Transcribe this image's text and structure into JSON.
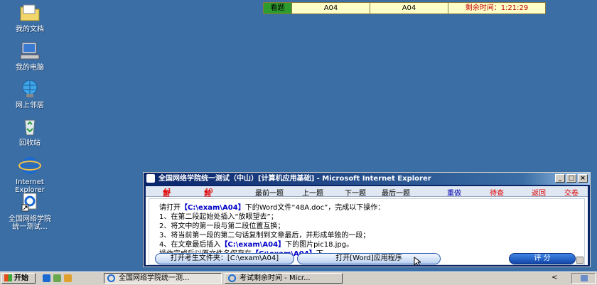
{
  "status_bar": {
    "badge": "看题",
    "cell1": "A04",
    "cell2": "A04",
    "time_remaining": "剩余时间：1:21:29"
  },
  "desktop_icons": [
    {
      "label": "我的文档",
      "icon": "folder-icon"
    },
    {
      "label": "我的电脑",
      "icon": "computer-icon"
    },
    {
      "label": "网上邻居",
      "icon": "network-icon"
    },
    {
      "label": "回收站",
      "icon": "recycle-bin-icon"
    },
    {
      "label": "Internet\nExplorer",
      "icon": "ie-icon"
    },
    {
      "label": "全国网络学院\n统一测试...",
      "icon": "shortcut-icon"
    }
  ],
  "exam_window": {
    "title": "全国网络学院统一测试（中山）[计算机应用基础] - Microsoft Internet Explorer",
    "win_buttons": {
      "minimize": "_",
      "maximize": "□",
      "close": "×"
    },
    "nav": {
      "question_prefix": "第",
      "question_num": "41",
      "question_suffix": "题",
      "total_prefix": "共",
      "total_num": "49",
      "total_suffix": "题",
      "first": "最前一题",
      "prev": "上一题",
      "next": "下一题",
      "last": "最后一题",
      "redo": "重做",
      "review": "待查",
      "back": "返回",
      "submit": "交卷"
    },
    "instructions": {
      "l1_a": "请打开",
      "l1_path": "【C:\\exam\\A04】",
      "l1_b": "下的Word文件“48A.doc”，完成以下操作：",
      "l2": "1、在第二段起始处插入“放眼望去”；",
      "l3": "2、将文中的第一段与第二段位置互换；",
      "l4": "3、将当前第一段的第二句话复制到文章最后，并形成单独的一段；",
      "l5_a": "4、在文章最后插入",
      "l5_path": "【C:\\exam\\A04】",
      "l5_b": "下的图片pic18.jpg。",
      "l6_a": "操作完成后以原文件名保存在",
      "l6_path": "【C:\\exam\\A04】",
      "l6_b": "下。"
    },
    "buttons": {
      "open_folder": "打开考生文件夹：[C:\\exam\\A04]",
      "open_word": "打开[Word]应用程序",
      "score": "评  分"
    }
  },
  "taskbar": {
    "start": "开始",
    "tasks": [
      "全国网络学院统一测...",
      "考试剩余时间 - Micr..."
    ],
    "tray_arrow": "<"
  },
  "colors": {
    "desktop": "#3a6ea5",
    "title_active": "#0a246a",
    "accent_red": "#e00000",
    "path_blue": "#0000c8"
  }
}
